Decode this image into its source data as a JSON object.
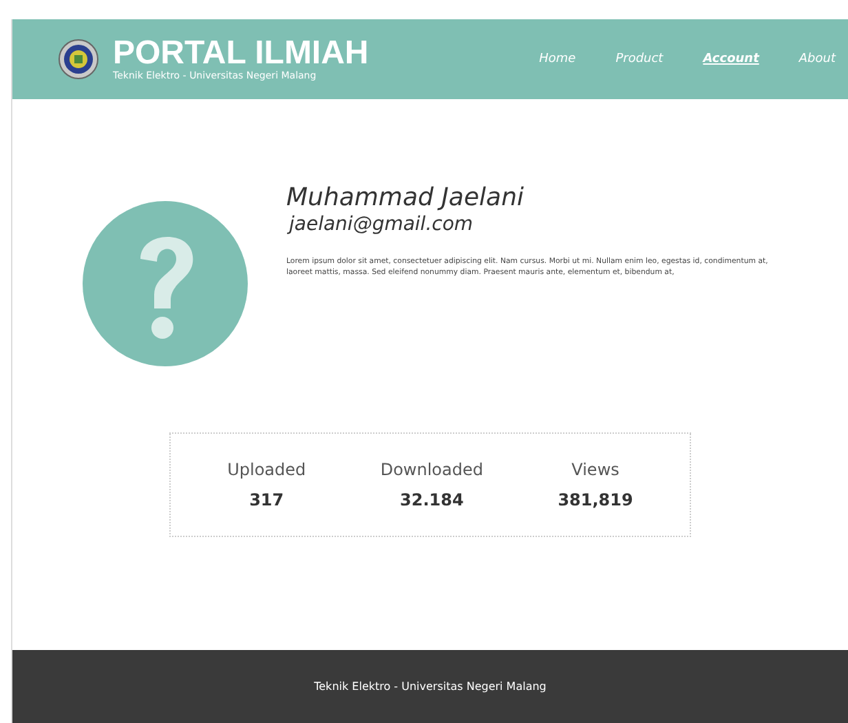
{
  "header": {
    "title": "PORTAL ILMIAH",
    "subtitle": "Teknik Elektro - Universitas Negeri Malang"
  },
  "nav": [
    {
      "label": "Home",
      "selected": false
    },
    {
      "label": "Product",
      "selected": false
    },
    {
      "label": "Account",
      "selected": true
    },
    {
      "label": "About",
      "selected": false
    }
  ],
  "profile": {
    "name": "Muhammad Jaelani",
    "email": "jaelani@gmail.com",
    "bio": "Lorem ipsum dolor sit amet, consectetuer adipiscing elit. Nam cursus. Morbi ut mi. Nullam enim leo, egestas id, condimentum at, laoreet mattis, massa. Sed eleifend nonummy diam. Praesent mauris ante, elementum et, bibendum at,"
  },
  "stats": [
    {
      "label": "Uploaded",
      "value": "317"
    },
    {
      "label": "Downloaded",
      "value": "32.184"
    },
    {
      "label": "Views",
      "value": "381,819"
    }
  ],
  "footer": {
    "text": "Teknik Elektro - Universitas Negeri Malang"
  }
}
